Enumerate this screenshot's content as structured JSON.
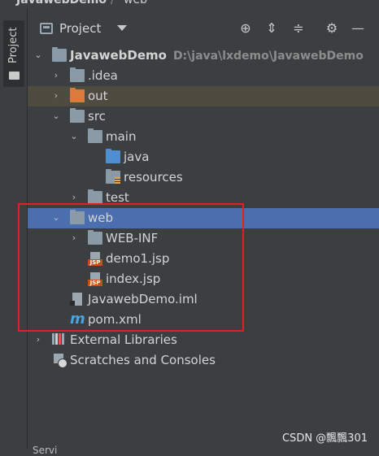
{
  "window": {
    "breadcrumb_project": "JavawebDemo",
    "breadcrumb_folder": "web"
  },
  "sidebar_stripe": {
    "tab_label": "Project"
  },
  "panel": {
    "title": "Project",
    "toolbar": [
      "target-icon",
      "expand-all-icon",
      "collapse-all-icon",
      "gear-icon",
      "minimize-icon"
    ]
  },
  "tree": {
    "root": {
      "label": "JavawebDemo",
      "path": "D:\\java\\lxdemo\\JavawebDemo"
    },
    "idea": ".idea",
    "out": "out",
    "src": "src",
    "main": "main",
    "java": "java",
    "resources": "resources",
    "test": "test",
    "web": "web",
    "webinf": "WEB-INF",
    "demo1": "demo1.jsp",
    "index": "index.jsp",
    "iml": "JavawebDemo.iml",
    "pom": "pom.xml",
    "libs": "External Libraries",
    "scratches": "Scratches and Consoles",
    "jsp_badge": "JSP",
    "pom_glyph": "m"
  },
  "colors": {
    "selection": "#4b6eaf",
    "excluded_row": "#4f4b41",
    "highlight_box": "#e0221e",
    "jsp_badge": "#c6501c",
    "source_folder": "#4f8fcf",
    "excluded_folder": "#d97b3a"
  },
  "watermark": "CSDN @飄飄301",
  "bottom_fragment": "Servi"
}
